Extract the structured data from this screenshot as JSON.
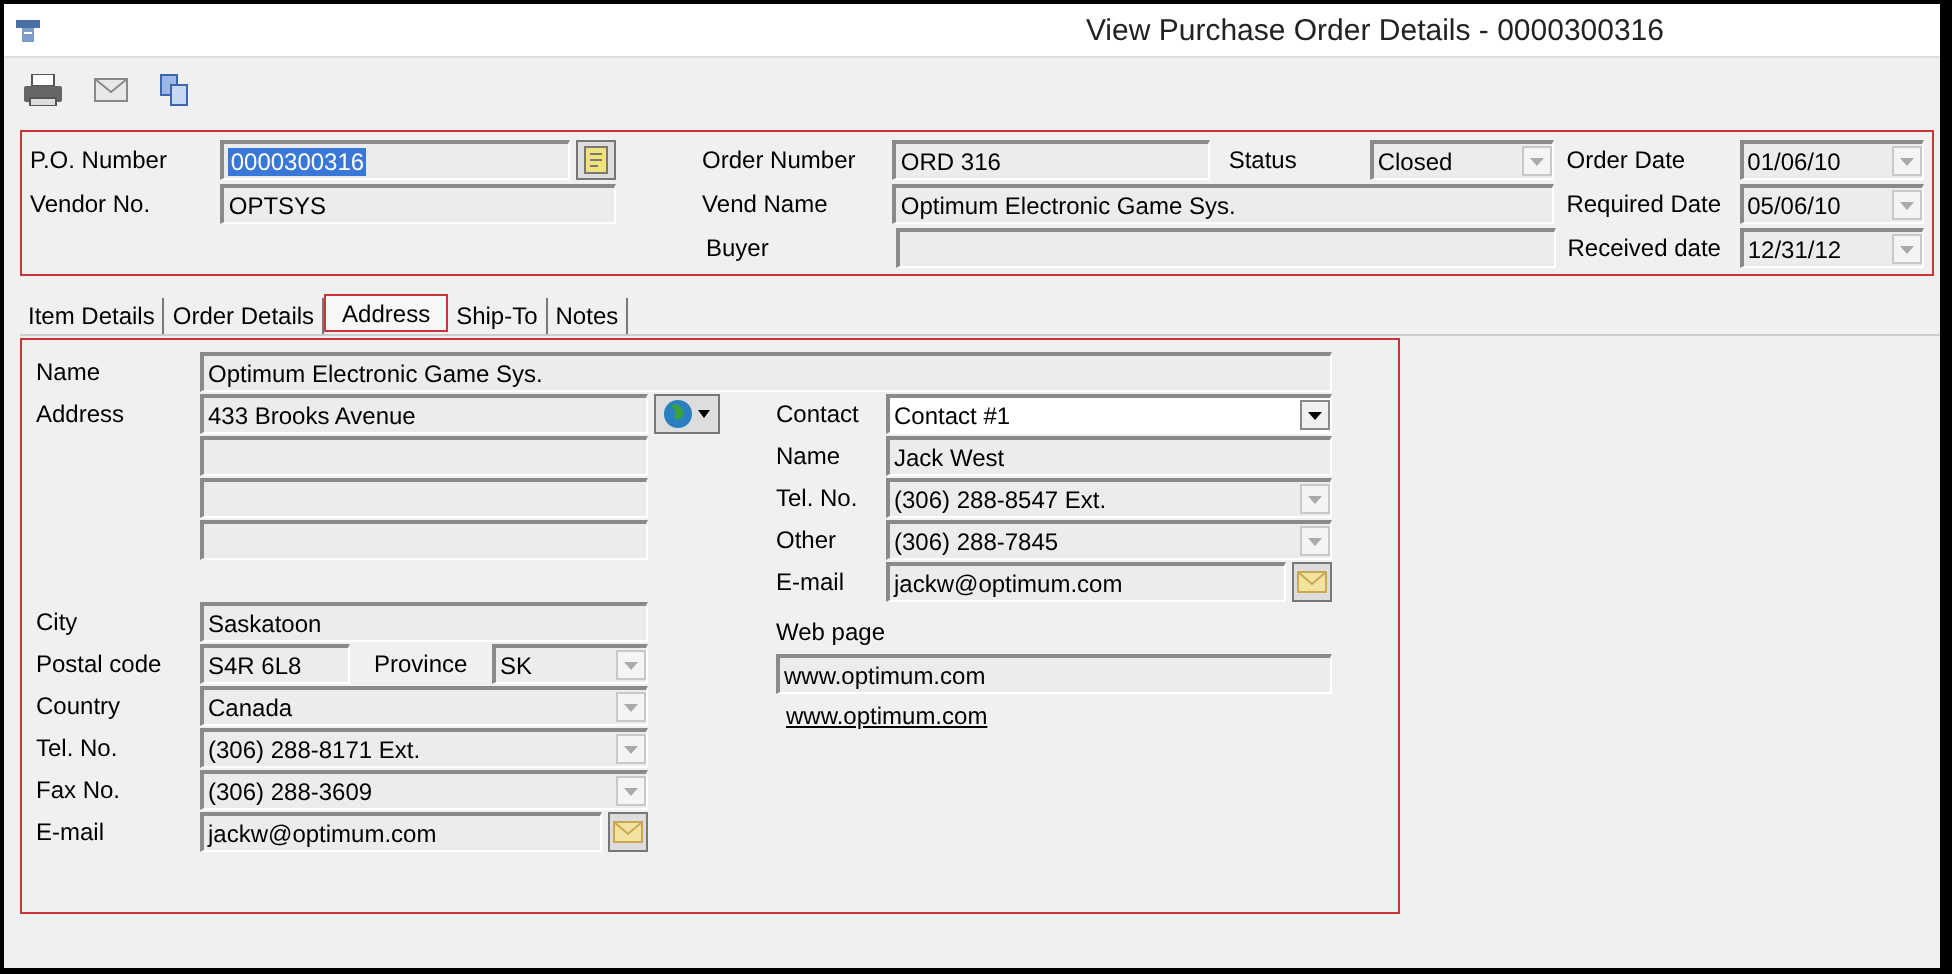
{
  "window": {
    "title": "View Purchase Order Details - 0000300316"
  },
  "header": {
    "po_number": {
      "label": "P.O. Number",
      "value": "0000300316",
      "selected": true
    },
    "vendor_no": {
      "label": "Vendor No.",
      "value": "OPTSYS"
    },
    "order_number": {
      "label": "Order Number",
      "value": "ORD 316"
    },
    "status": {
      "label": "Status",
      "value": "Closed",
      "disabled": true
    },
    "vend_name": {
      "label": "Vend Name",
      "value": "Optimum Electronic Game Sys."
    },
    "buyer": {
      "label": "Buyer"
    },
    "order_date": {
      "label": "Order Date",
      "value": "01/06/10",
      "disabled": true
    },
    "required_date": {
      "label": "Required Date",
      "value": "05/06/10",
      "disabled": true
    },
    "received_date": {
      "label": "Received date",
      "value": "12/31/12",
      "disabled": true
    }
  },
  "tabs": [
    {
      "label": "Item Details",
      "selected": false
    },
    {
      "label": "Order Details",
      "selected": false
    },
    {
      "label": "Address",
      "selected": true
    },
    {
      "label": "Ship-To",
      "selected": false
    },
    {
      "label": "Notes",
      "selected": false
    }
  ],
  "address": {
    "name": {
      "label": "Name",
      "value": "Optimum Electronic Game Sys."
    },
    "address": {
      "label": "Address",
      "lines": [
        {
          "kind": "filled",
          "value": "433 Brooks Avenue"
        },
        {
          "kind": "blank"
        },
        {
          "kind": "blank"
        },
        {
          "kind": "blank"
        }
      ]
    },
    "left": [
      {
        "kind": "text",
        "label": "City",
        "value": "Saskatoon"
      },
      {
        "kind": "postal",
        "label": "Postal code",
        "value": "S4R 6L8",
        "province": {
          "label": "Province",
          "value": "SK",
          "disabled": true
        }
      },
      {
        "kind": "combo",
        "label": "Country",
        "value": "Canada",
        "disabled": true
      },
      {
        "kind": "combo",
        "label": "Tel. No.",
        "value": "(306) 288-8171 Ext.",
        "disabled": true
      },
      {
        "kind": "combo",
        "label": "Fax No.",
        "value": "(306) 288-3609",
        "disabled": true
      },
      {
        "kind": "email",
        "label": "E-mail",
        "value": "jackw@optimum.com"
      }
    ],
    "contact": [
      {
        "kind": "combo",
        "label": "Contact",
        "value": "Contact #1",
        "disabled": false
      },
      {
        "kind": "text",
        "label": "Name",
        "value": "Jack West"
      },
      {
        "kind": "combo",
        "label": "Tel. No.",
        "value": "(306) 288-8547 Ext.",
        "disabled": true
      },
      {
        "kind": "combo",
        "label": "Other",
        "value": "(306) 288-7845",
        "disabled": true
      },
      {
        "kind": "email",
        "label": "E-mail",
        "value": "jackw@optimum.com"
      }
    ],
    "web_page": {
      "label": "Web page",
      "value": "www.optimum.com",
      "link": "www.optimum.com"
    }
  }
}
